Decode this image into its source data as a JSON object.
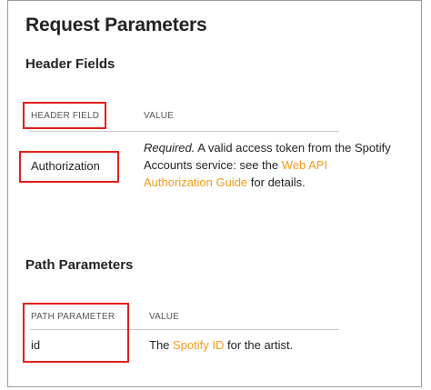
{
  "title": "Request Parameters",
  "header_fields": {
    "heading": "Header Fields",
    "col_field": "HEADER FIELD",
    "col_value": "VALUE",
    "rows": [
      {
        "name": "Authorization",
        "desc_required": "Required.",
        "desc_text1": " A valid access token from the Spotify Accounts service: see the ",
        "desc_link": "Web API Authorization Guide",
        "desc_text2": " for details."
      }
    ]
  },
  "path_parameters": {
    "heading": "Path Parameters",
    "col_param": "PATH PARAMETER",
    "col_value": "VALUE",
    "rows": [
      {
        "name": "id",
        "desc_text1": "The ",
        "desc_link": "Spotify ID",
        "desc_text2": " for the artist."
      }
    ]
  },
  "colors": {
    "highlight": "#e2201b",
    "link": "#f29b1b"
  }
}
